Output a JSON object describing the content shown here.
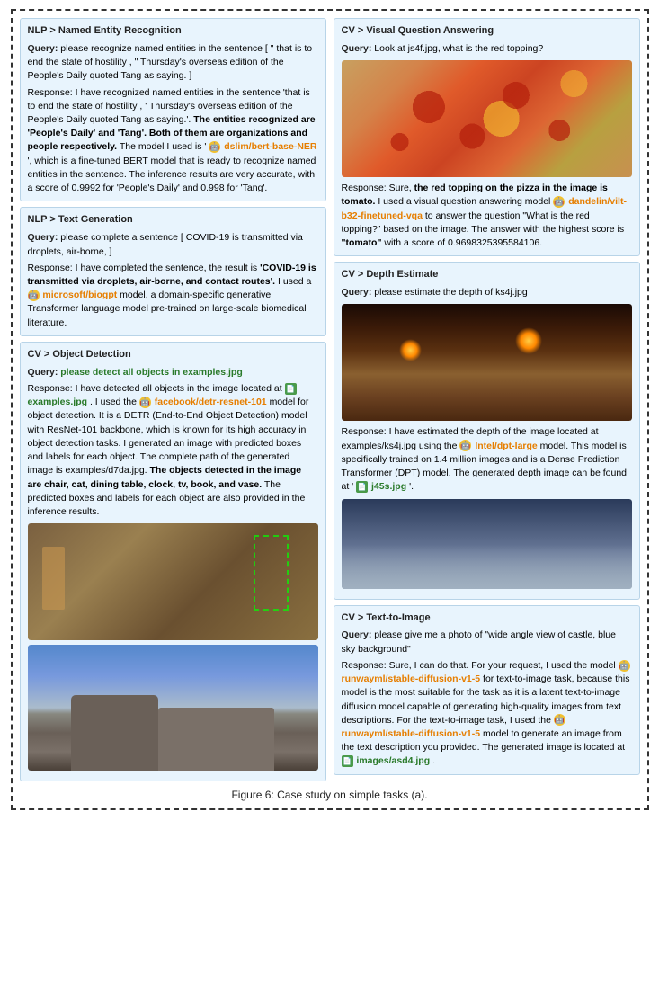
{
  "figure_caption": "Figure 6: Case study on simple tasks (a).",
  "left_col": {
    "nlp_ner": {
      "title": "NLP > Named Entity Recognition",
      "query_label": "Query:",
      "query_text": "please recognize named entities in the sentence [ \" that is to end the state of hostility , \" Thursday's overseas edition of the People's Daily quoted Tang as saying. ]",
      "response_label": "Response:",
      "response_text_1": "I have recognized named entities in the sentence 'that is to end the state of hostility , ' Thursday's overseas edition of the People's Daily quoted Tang as saying.'. ",
      "response_bold": "The entities recognized are 'People's Daily' and 'Tang'. Both of them are organizations and people respectively.",
      "response_text_2": " The model I used is ' ",
      "model_link": "dslim/bert-base-NER",
      "response_text_3": "', which is a fine-tuned BERT model that is ready to recognize named entities in the sentence. The inference results are very accurate, with a score of 0.9992 for 'People's Daily' and 0.998 for 'Tang'."
    },
    "nlp_text_gen": {
      "title": "NLP > Text Generation",
      "query_label": "Query:",
      "query_text": "please complete a sentence [ COVID-19 is transmitted via droplets, air-borne, ]",
      "response_label": "Response:",
      "response_text_1": "I have completed the sentence, the result is ",
      "response_bold": "'COVID-19 is transmitted via droplets, air-borne, and contact routes'.",
      "response_text_2": " I used a ",
      "model_link": "microsoft/biogpt",
      "response_text_3": " model, a domain-specific generative Transformer language model pre-trained on large-scale biomedical literature."
    },
    "cv_object_detection": {
      "title": "CV > Object Detection",
      "query_label": "Query:",
      "query_text": "please detect all objects in examples.jpg",
      "response_label": "Response:",
      "response_text_1": "I have detected all objects in the image located at ",
      "file_link": "examples.jpg",
      "response_text_2": ". I used the ",
      "model_link": "facebook/detr-resnet-101",
      "response_text_3": " model for object detection. It is a DETR (End-to-End Object Detection) model with ResNet-101 backbone, which is known for its high accuracy in object detection tasks. I generated an image with predicted boxes and labels for each object. The complete path of the generated image is examples/d7da.jpg. ",
      "response_bold": "The objects detected in the image are chair, cat, dining table, clock, tv, book, and vase.",
      "response_text_4": " The predicted boxes and labels for each object are also provided in the inference results."
    }
  },
  "right_col": {
    "cv_vqa": {
      "title": "CV > Visual Question Answering",
      "query_label": "Query:",
      "query_text": "Look at js4f.jpg, what is the red topping?",
      "response_label": "Response:",
      "response_text_1": "Sure, ",
      "response_bold": "the red topping on the pizza in the image is tomato.",
      "response_text_2": " I used a visual question answering model ",
      "model_link": "dandelin/vilt-b32-finetuned-vqa",
      "response_text_3": " to answer the question \"What is the red topping?\" based on the image. The answer with the highest score is ",
      "answer_bold": "\"tomato\"",
      "response_text_4": " with a score of 0.9698325395584106."
    },
    "cv_depth": {
      "title": "CV > Depth Estimate",
      "query_label": "Query:",
      "query_text": "please estimate the depth of ks4j.jpg",
      "response_label": "Response:",
      "response_text_1": "I have estimated the depth of the image located at examples/ks4j.jpg using the ",
      "model_link": "Intel/dpt-large",
      "response_text_2": " model. This model is specifically trained on 1.4 million images and is a Dense Prediction Transformer (DPT) model. The generated depth image can be found at ' ",
      "file_link": "j45s.jpg",
      "response_text_3": "'."
    },
    "cv_text2image": {
      "title": "CV > Text-to-Image",
      "query_label": "Query:",
      "query_text": "please give me a photo of \"wide angle view of castle, blue sky background\"",
      "response_label": "Response:",
      "response_text_1": "Sure, I can do that. For your request, I used the model ",
      "model_link": "runwayml/stable-diffusion-v1-5",
      "response_text_2": " for text-to-image task, because this model is the most suitable for the task as it is a latent text-to-image diffusion model capable of generating high-quality images from text descriptions. For the text-to-image task, I used the ",
      "model_link2": "runwayml/stable-diffusion-v1-5",
      "response_text_3": " model to generate an image from the text description you provided. The generated image is located at ",
      "file_link": "images/asd4.jpg",
      "response_text_4": "."
    }
  }
}
